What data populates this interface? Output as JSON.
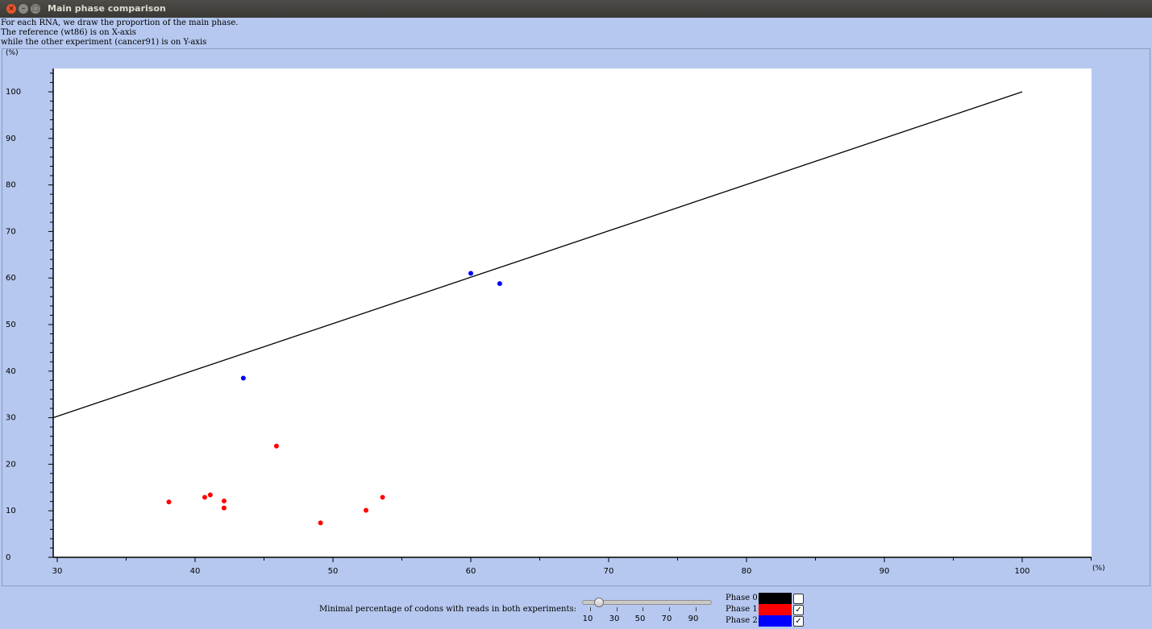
{
  "window": {
    "title": "Main phase comparison"
  },
  "description": [
    "For each RNA, we draw the proportion of the main phase.",
    "The reference (wt86) is on X-axis",
    "while the other experiment (cancer91) is on Y-axis"
  ],
  "chart_data": {
    "type": "scatter",
    "x_unit": "(%)",
    "y_unit": "(%)",
    "xlim": [
      30,
      105
    ],
    "ylim": [
      0,
      105
    ],
    "x_ticks": [
      30,
      40,
      50,
      60,
      70,
      80,
      90,
      100
    ],
    "y_ticks": [
      0,
      10,
      20,
      30,
      40,
      50,
      60,
      70,
      80,
      90,
      100
    ],
    "reference_line": {
      "x": [
        30,
        100
      ],
      "y": [
        30,
        100
      ]
    },
    "series": [
      {
        "color": "#ff0000",
        "points": [
          [
            38.1,
            11.9
          ],
          [
            40.7,
            12.9
          ],
          [
            41.1,
            13.4
          ],
          [
            42.1,
            12.1
          ],
          [
            42.1,
            10.6
          ],
          [
            45.9,
            23.9
          ],
          [
            49.1,
            7.4
          ],
          [
            52.4,
            10.1
          ],
          [
            53.6,
            12.9
          ]
        ]
      },
      {
        "color": "#0000ff",
        "points": [
          [
            43.5,
            38.5
          ],
          [
            60.0,
            61.0
          ],
          [
            62.1,
            58.8
          ]
        ]
      }
    ]
  },
  "controls": {
    "slider": {
      "label": "Minimal percentage of codons with reads in both experiments:",
      "ticks": [
        "10",
        "30",
        "50",
        "70",
        "90"
      ],
      "value": 20
    },
    "legend": [
      {
        "label": "Phase 0:",
        "color": "#000000",
        "checked": false,
        "mark": ""
      },
      {
        "label": "Phase 1:",
        "color": "#ff0000",
        "checked": true,
        "mark": "✓"
      },
      {
        "label": "Phase 2:",
        "color": "#0000ff",
        "checked": true,
        "mark": "✓"
      }
    ]
  }
}
